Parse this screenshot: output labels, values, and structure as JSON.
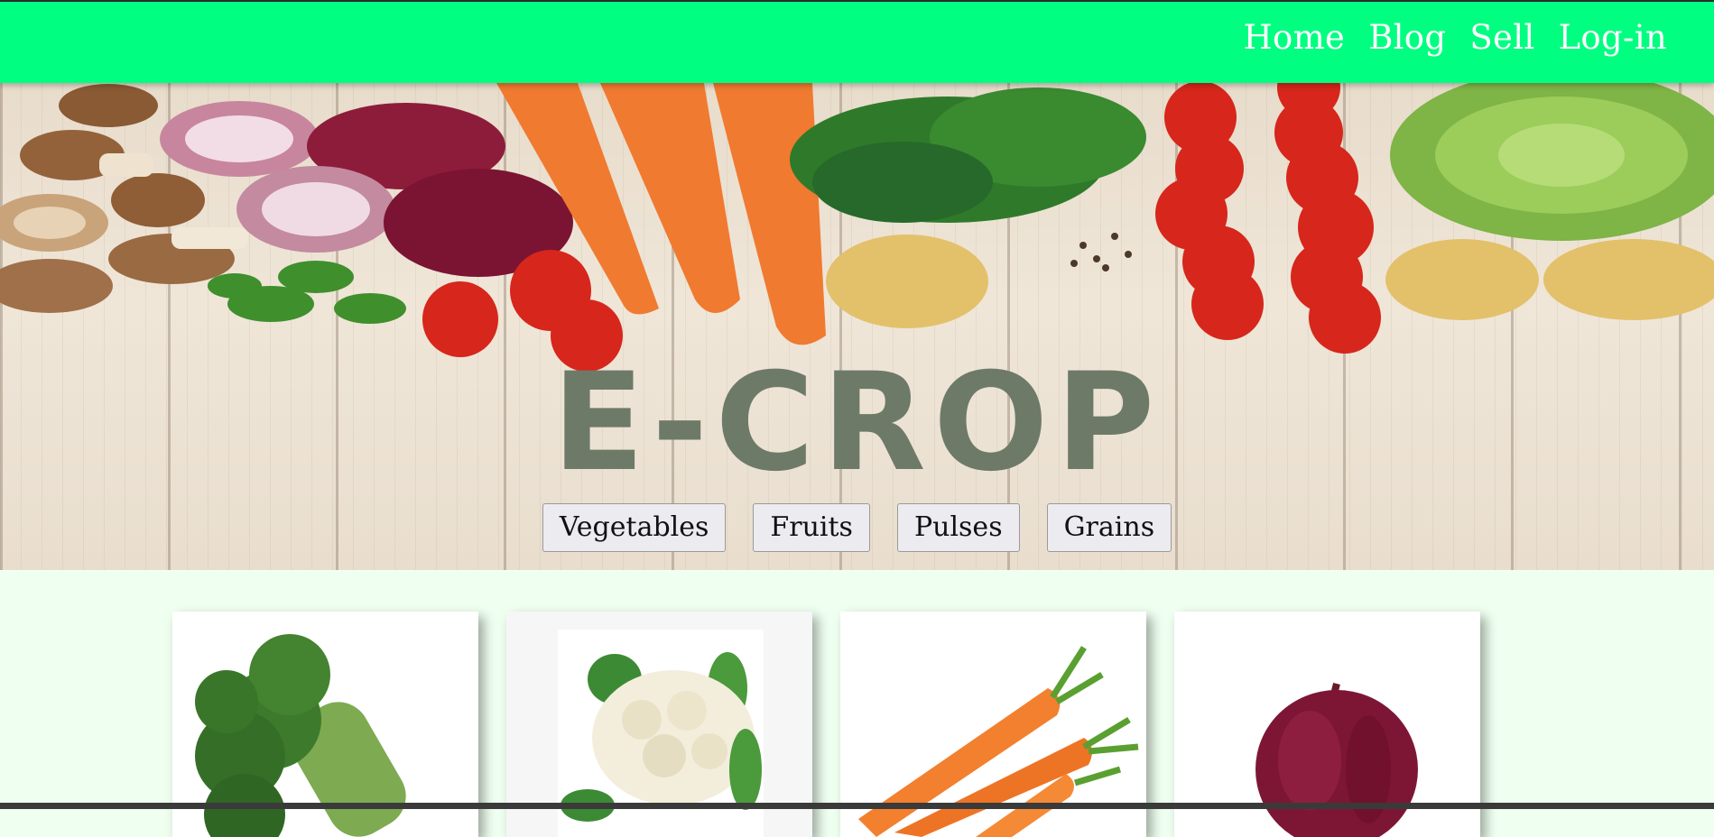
{
  "nav": {
    "items": [
      {
        "label": "Home"
      },
      {
        "label": "Blog"
      },
      {
        "label": "Sell"
      },
      {
        "label": "Log-in"
      }
    ]
  },
  "hero": {
    "title": "E-CROP",
    "categories": [
      {
        "label": "Vegetables"
      },
      {
        "label": "Fruits"
      },
      {
        "label": "Pulses"
      },
      {
        "label": "Grains"
      }
    ]
  },
  "products": [
    {
      "image": "broccoli"
    },
    {
      "image": "cauliflower"
    },
    {
      "image": "carrots"
    },
    {
      "image": "red-onion"
    }
  ],
  "colors": {
    "nav_bar": "#00ff80",
    "page_background": "#effff0",
    "title": "#6e7a68"
  }
}
